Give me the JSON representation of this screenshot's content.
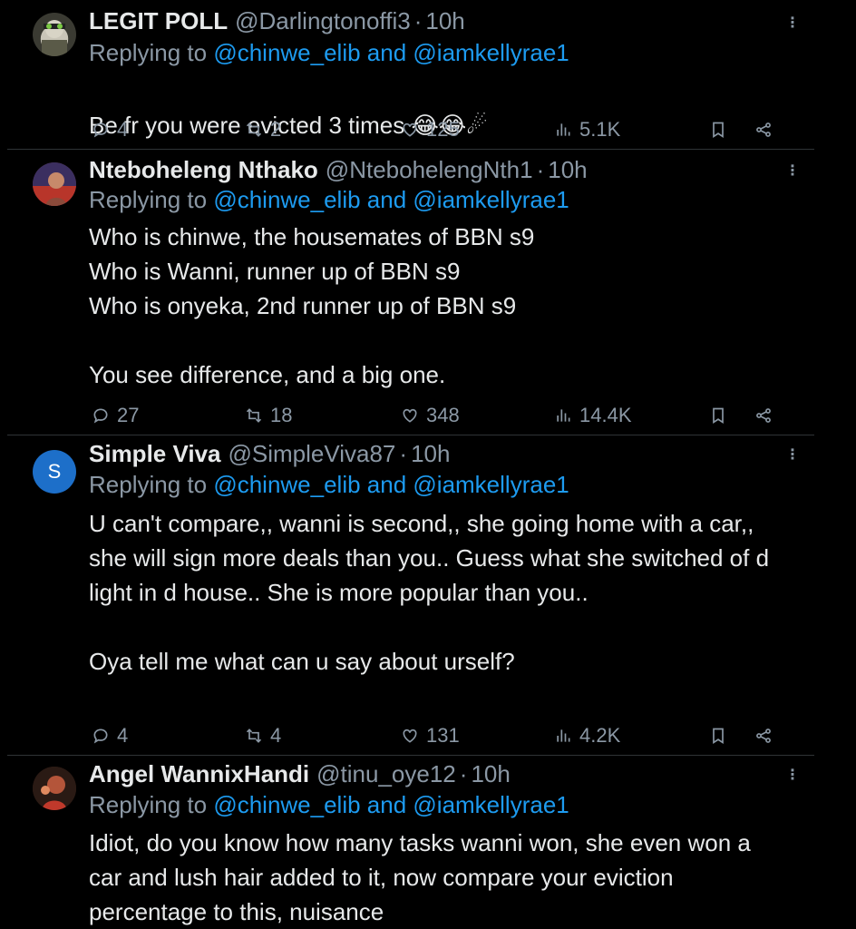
{
  "tweets": [
    {
      "name": "LEGIT POLL",
      "handle": "@Darlingtonoffi3",
      "time": "10h",
      "replying_prefix": "Replying to ",
      "replying_users": "@chinwe_elib and @iamkellyrae1",
      "text": "Be fr you were evicted 3 times",
      "emoji": "😂😂☄",
      "replies": "4",
      "reposts": "2",
      "likes": "125",
      "views": "5.1K"
    },
    {
      "name": "Nteboheleng Nthako",
      "handle": "@NtebohelengNth1",
      "time": "10h",
      "replying_prefix": "Replying to ",
      "replying_users": "@chinwe_elib and @iamkellyrae1",
      "text": "Who is chinwe, the housemates of BBN s9\nWho is Wanni, runner up of BBN s9\nWho is onyeka, 2nd runner up of BBN s9\n\nYou see difference, and a big one.",
      "replies": "27",
      "reposts": "18",
      "likes": "348",
      "views": "14.4K"
    },
    {
      "name": "Simple Viva",
      "handle": "@SimpleViva87",
      "time": "10h",
      "avatar_letter": "S",
      "replying_prefix": "Replying to ",
      "replying_users": "@chinwe_elib and @iamkellyrae1",
      "text": "U can't compare,, wanni is second,, she going home with a car,, she will sign more deals than you.. Guess what she switched of d light in d house.. She is more popular than you..\n\nOya tell me what can u say about urself?",
      "replies": "4",
      "reposts": "4",
      "likes": "131",
      "views": "4.2K"
    },
    {
      "name": "Angel WannixHandi",
      "handle": "@tinu_oye12",
      "time": "10h",
      "replying_prefix": "Replying to ",
      "replying_users": "@chinwe_elib and @iamkellyrae1",
      "text": "Idiot, do you know how many tasks wanni won, she even won a car and lush hair added to it, now compare your eviction percentage to this, nuisance"
    }
  ],
  "separator": "·",
  "colors": {
    "background": "#000000",
    "text": "#e7e9ea",
    "muted": "#8b98a5",
    "link": "#1d9bf0",
    "divider": "#2f3336",
    "avatar_s": "#1d6fc9"
  },
  "icons": [
    "reply-icon",
    "repost-icon",
    "like-icon",
    "views-icon",
    "bookmark-icon",
    "share-icon",
    "more-icon"
  ]
}
